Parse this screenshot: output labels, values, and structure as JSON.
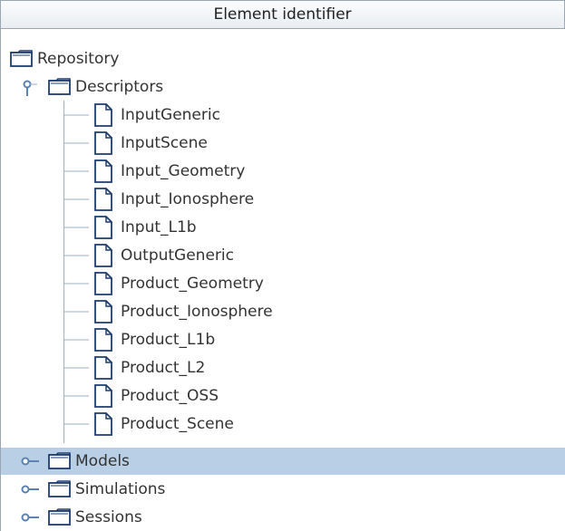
{
  "header": {
    "title": "Element identifier"
  },
  "tree": {
    "root": {
      "label": "Repository",
      "icon": "folder-icon"
    },
    "descriptors": {
      "label": "Descriptors",
      "icon": "folder-icon",
      "expanded": true,
      "children": [
        "InputGeneric",
        "InputScene",
        "Input_Geometry",
        "Input_Ionosphere",
        "Input_L1b",
        "OutputGeneric",
        "Product_Geometry",
        "Product_Ionosphere",
        "Product_L1b",
        "Product_L2",
        "Product_OSS",
        "Product_Scene"
      ]
    },
    "models": {
      "label": "Models",
      "icon": "folder-icon",
      "selected": true
    },
    "simulations": {
      "label": "Simulations",
      "icon": "folder-icon"
    },
    "sessions": {
      "label": "Sessions",
      "icon": "folder-icon"
    }
  },
  "colors": {
    "selection": "#b8cfe5",
    "icon_stroke": "#1d3c6e",
    "handle": "#5b82b1"
  }
}
